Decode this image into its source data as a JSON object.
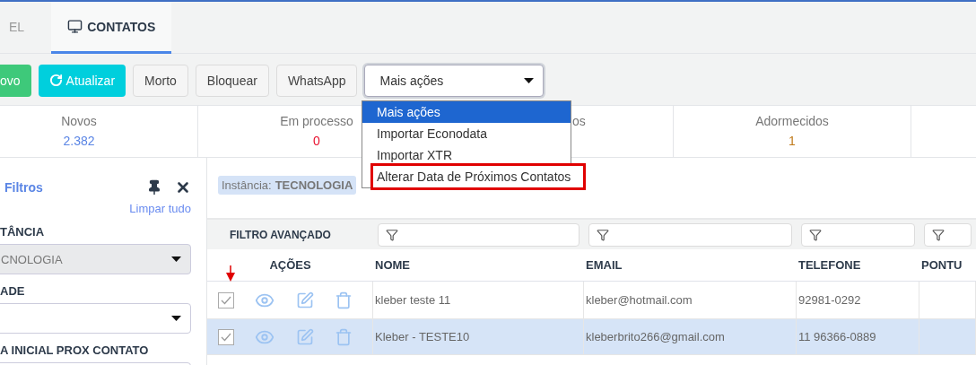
{
  "tabs": [
    {
      "label": "EL",
      "selected": false
    },
    {
      "label": "CONTATOS",
      "selected": true
    }
  ],
  "toolbar": {
    "buttons": [
      {
        "label": "ovo",
        "kind": "success"
      },
      {
        "label": "Atualizar",
        "kind": "info"
      },
      {
        "label": "Morto",
        "kind": "plain"
      },
      {
        "label": "Bloquear",
        "kind": "plain"
      },
      {
        "label": "WhatsApp",
        "kind": "plain"
      }
    ],
    "select": {
      "value": "Mais ações",
      "expanded": true,
      "options": [
        {
          "label": "Mais ações",
          "selected": true,
          "highlighted": false
        },
        {
          "label": "Importar Econodata",
          "selected": false,
          "highlighted": false
        },
        {
          "label": "Importar XTR",
          "selected": false,
          "highlighted": false
        },
        {
          "label": "Alterar Data de Próximos Contatos",
          "selected": false,
          "highlighted": true
        }
      ]
    }
  },
  "stats": [
    {
      "label": "Novos",
      "value": "2.382",
      "color": "#5b86e5"
    },
    {
      "label": "Em processo",
      "value": "0",
      "color": "#e8102e"
    },
    {
      "label": "os"
    },
    {
      "label": "Adormecidos",
      "value": "1",
      "color": "#c07a1a"
    }
  ],
  "sidebar": {
    "title": "Filtros",
    "clear": "Limpar tudo",
    "fields": [
      {
        "label": "TÂNCIA",
        "value": "CNOLOGIA",
        "disabled": true,
        "kind": "select"
      },
      {
        "label": "ADE",
        "disabled": false,
        "kind": "select"
      },
      {
        "label": "A INICIAL PROX CONTATO",
        "disabled": false,
        "kind": "date"
      }
    ]
  },
  "chip": {
    "label": "Instância:",
    "value": "TECNOLOGIA"
  },
  "table": {
    "filter_label": "FILTRO AVANÇADO",
    "columns": [
      "AÇÕES",
      "NOME",
      "EMAIL",
      "TELEFONE",
      "PONTU"
    ],
    "rows": [
      {
        "checked": true,
        "selected": false,
        "cells": [
          "",
          "kleber teste 11",
          "kleber@hotmail.com",
          "92981-0292",
          ""
        ]
      },
      {
        "checked": true,
        "selected": true,
        "cells": [
          "",
          "Kleber - TESTE10",
          "kleberbrito266@gmail.com",
          "11 96366-0889",
          ""
        ]
      }
    ]
  }
}
